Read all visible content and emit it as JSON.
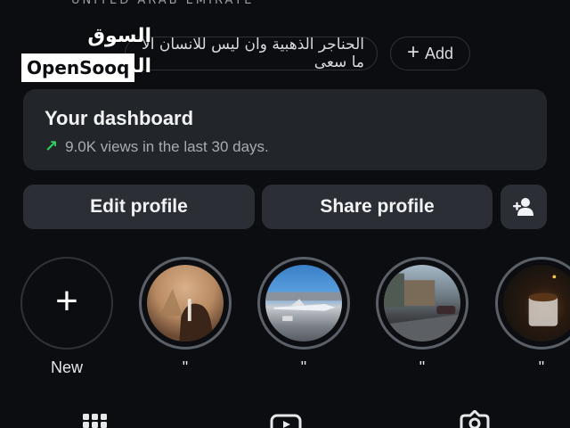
{
  "header": {
    "caption": "UNITED ARAB EMIRATE",
    "watermark_ar": "السوق المفتوح",
    "watermark_en": "OpenSooq"
  },
  "links": {
    "link_text": "الحناجر الذهبية وان ليس للانسان الا ما سعى",
    "add_label": "Add",
    "add_icon": "plus-icon"
  },
  "dashboard": {
    "title": "Your dashboard",
    "subtitle": "9.0K views in the last 30 days.",
    "trend_icon": "trend-up-icon",
    "trend_color": "#2fcf5b"
  },
  "actions": {
    "edit_label": "Edit profile",
    "share_label": "Share profile",
    "add_user_icon": "add-person-icon"
  },
  "highlights": [
    {
      "label": "New",
      "icon": "plus-icon"
    },
    {
      "label": "\""
    },
    {
      "label": "\""
    },
    {
      "label": "\""
    },
    {
      "label": "\""
    }
  ],
  "tabs": [
    {
      "icon": "grid-icon"
    },
    {
      "icon": "reels-icon"
    },
    {
      "icon": "tagged-icon"
    }
  ],
  "colors": {
    "background": "#0b0d10",
    "card": "#22262b",
    "button": "#2b2f35"
  }
}
